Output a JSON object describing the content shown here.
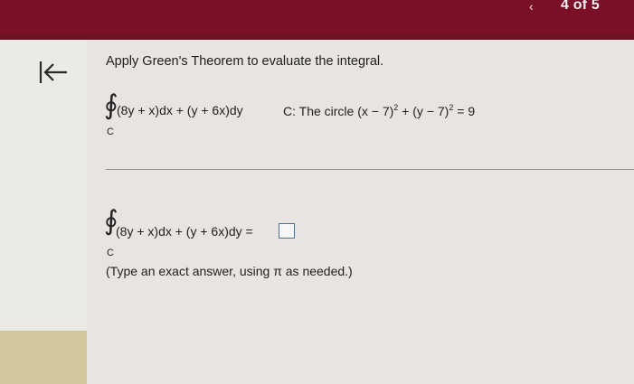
{
  "header": {
    "prev_icon": "chevron-left",
    "page_counter": "4 of 5",
    "colors": {
      "bar": "#7a1028",
      "accent": "#4c6f9d"
    }
  },
  "sidebar": {
    "collapse_icon": "collapse-left-arrow"
  },
  "question": {
    "instruction": "Apply Green's Theorem to evaluate the integral.",
    "integral_symbol": "∮",
    "integrand": "(8y + x)dx + (y + 6x)dy",
    "contour_label": "C",
    "curve_label": "C: The circle",
    "curve_part1": "(x − 7)",
    "exp1": "2",
    "curve_plus": " + (y − 7)",
    "exp2": "2",
    "curve_rhs": " = 9"
  },
  "answer": {
    "integral_symbol": "∮",
    "integrand": "(8y + x)dx + (y + 6x)dy =",
    "contour_label": "C",
    "answer_value": "",
    "hint": "(Type an exact answer, using π as needed.)"
  }
}
